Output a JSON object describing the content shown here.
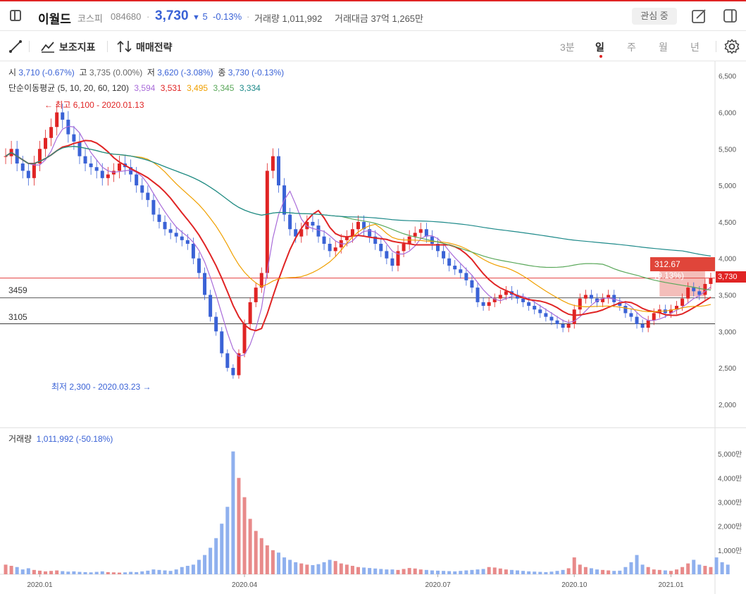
{
  "header": {
    "name": "이월드",
    "market": "코스피",
    "code": "084680",
    "price": "3,730",
    "change_arrow": "▼",
    "change": "5",
    "change_pct": "-0.13%",
    "volume_label": "거래량",
    "volume": "1,011,992",
    "amount_label": "거래대금",
    "amount": "37억 1,265만",
    "watch_label": "관심 중"
  },
  "toolbar": {
    "indicator_label": "보조지표",
    "strategy_label": "매매전략",
    "periods": [
      "3분",
      "일",
      "주",
      "월",
      "년"
    ],
    "active_period": "일"
  },
  "ohlc": {
    "open_label": "시",
    "open": "3,710 (-0.67%)",
    "high_label": "고",
    "high": "3,735 (0.00%)",
    "low_label": "저",
    "low": "3,620 (-3.08%)",
    "close_label": "종",
    "close": "3,730 (-0.13%)"
  },
  "ma": {
    "label": "단순이동평균 (5, 10, 20, 60, 120)",
    "values": [
      "3,594",
      "3,531",
      "3,495",
      "3,345",
      "3,334"
    ],
    "colors": [
      "#a86bd9",
      "#e02424",
      "#f0a000",
      "#5aa85a",
      "#1e8a8a"
    ]
  },
  "annotations": {
    "high": "← 최고 6,100 - 2020.01.13",
    "low": "최저 2,300 - 2020.03.23 →",
    "level1": "3459",
    "level2": "3105",
    "measure": "312.67  (9.13%)",
    "current_price_tag": "3,730"
  },
  "volume_panel": {
    "label": "거래량",
    "value": "1,011,992 (-50.18%)"
  },
  "chart_data": {
    "type": "candlestick",
    "price_axis": {
      "ticks": [
        "6,500",
        "6,000",
        "5,500",
        "5,000",
        "4,500",
        "4,000",
        "3,500",
        "3,000",
        "2,500",
        "2,000"
      ],
      "ylim": [
        1700,
        6700
      ]
    },
    "volume_axis": {
      "ticks": [
        "5,000만",
        "4,000만",
        "3,000만",
        "2,000만",
        "1,000만"
      ],
      "ylim": [
        0,
        5500
      ]
    },
    "x_axis_ticks": [
      "2020.01",
      "2020.04",
      "2020.07",
      "2020.10",
      "2021.01"
    ],
    "close_series": [
      5400,
      5500,
      5300,
      5200,
      5100,
      5300,
      5500,
      5650,
      5800,
      6000,
      5900,
      5700,
      5600,
      5400,
      5300,
      5250,
      5200,
      5100,
      5150,
      5200,
      5300,
      5250,
      5150,
      5000,
      4900,
      4800,
      4600,
      4500,
      4400,
      4350,
      4300,
      4250,
      4200,
      4000,
      3800,
      3500,
      3200,
      3000,
      2700,
      2500,
      2400,
      2700,
      3100,
      3400,
      3600,
      3800,
      5200,
      5400,
      5000,
      4600,
      4400,
      4300,
      4400,
      4500,
      4450,
      4300,
      4200,
      4100,
      4150,
      4250,
      4300,
      4400,
      4500,
      4400,
      4300,
      4200,
      4100,
      4000,
      3900,
      4100,
      4200,
      4300,
      4350,
      4400,
      4300,
      4200,
      4100,
      4000,
      3900,
      3850,
      3800,
      3700,
      3600,
      3400,
      3350,
      3400,
      3450,
      3500,
      3550,
      3500,
      3450,
      3400,
      3350,
      3300,
      3250,
      3200,
      3150,
      3100,
      3050,
      3100,
      3300,
      3450,
      3500,
      3450,
      3400,
      3450,
      3500,
      3400,
      3350,
      3250,
      3200,
      3100,
      3050,
      3150,
      3250,
      3300,
      3250,
      3300,
      3350,
      3450,
      3600,
      3550,
      3500,
      3650,
      3730
    ],
    "high": {
      "value": 6100,
      "date": "2020.01.13"
    },
    "low": {
      "value": 2300,
      "date": "2020.03.23"
    },
    "levels": [
      3459,
      3105
    ],
    "current_price": 3730,
    "volume_series": [
      400,
      350,
      300,
      200,
      250,
      180,
      150,
      120,
      140,
      160,
      130,
      110,
      120,
      100,
      90,
      80,
      100,
      120,
      90,
      80,
      70,
      80,
      100,
      90,
      120,
      150,
      200,
      180,
      160,
      140,
      200,
      300,
      350,
      400,
      600,
      800,
      1100,
      1500,
      2100,
      2800,
      5100,
      4000,
      3200,
      2300,
      1800,
      1500,
      1200,
      1000,
      900,
      700,
      600,
      500,
      450,
      400,
      380,
      420,
      500,
      600,
      550,
      450,
      400,
      350,
      300,
      280,
      260,
      240,
      220,
      200,
      200,
      180,
      220,
      260,
      240,
      200,
      180,
      160,
      150,
      140,
      130,
      120,
      140,
      160,
      180,
      200,
      220,
      300,
      280,
      240,
      200,
      180,
      160,
      140,
      120,
      110,
      100,
      90,
      110,
      140,
      180,
      250,
      700,
      400,
      300,
      250,
      200,
      180,
      160,
      140,
      150,
      300,
      500,
      800,
      400,
      300,
      200,
      180,
      160,
      140,
      200,
      300,
      450,
      600,
      400,
      350,
      300,
      700,
      500,
      400
    ]
  }
}
